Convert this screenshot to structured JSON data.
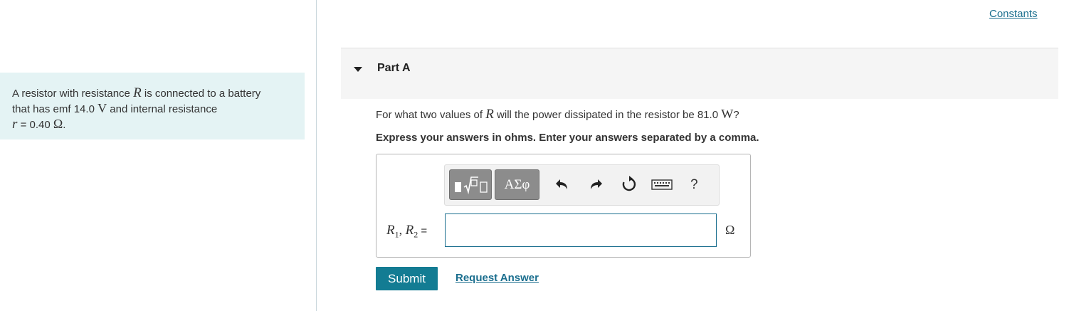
{
  "constants_link": "Constants",
  "problem": {
    "intro": "A resistor with resistance",
    "var_R": "R",
    "mid1": "is connected to a battery",
    "mid2": "that has emf",
    "emf_value": "14.0",
    "emf_unit": "V",
    "mid3": "and internal resistance",
    "var_r": "r",
    "r_value": "= 0.40",
    "r_unit": "Ω",
    "period": "."
  },
  "part": {
    "title": "Part A",
    "question_prefix": "For what two values of",
    "question_var": "R",
    "question_mid": "will the power dissipated in the resistor be 81.0",
    "question_unit": "W",
    "question_end": "?",
    "instruction": "Express your answers in ohms. Enter your answers separated by a comma."
  },
  "toolbar": {
    "symbols_label": "ΑΣφ",
    "help_label": "?",
    "icons": [
      "templates-icon",
      "symbols-icon",
      "undo-icon",
      "redo-icon",
      "reset-icon",
      "keyboard-icon",
      "help-icon"
    ]
  },
  "answer": {
    "label_R1": "R",
    "sub1": "1",
    "comma": ", ",
    "label_R2": "R",
    "sub2": "2",
    "equals": " =",
    "value": "",
    "unit": "Ω"
  },
  "buttons": {
    "submit": "Submit",
    "request_answer": "Request Answer"
  },
  "colors": {
    "accent": "#137c93",
    "link": "#1a6e8e",
    "problem_bg": "#e4f3f4",
    "header_bg": "#f5f5f5"
  }
}
